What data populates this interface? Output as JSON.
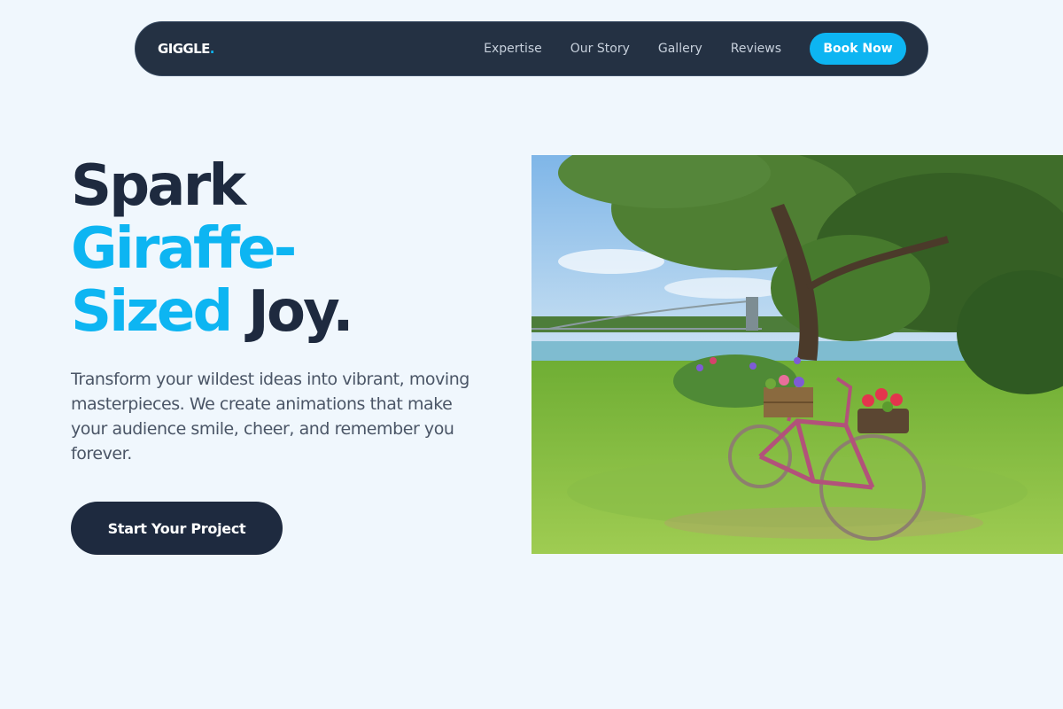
{
  "nav": {
    "logo": "GIGGLE",
    "logo_dot": ".",
    "links": [
      "Expertise",
      "Our Story",
      "Gallery",
      "Reviews"
    ],
    "cta": "Book Now"
  },
  "hero": {
    "title_line1": "Spark",
    "title_line2": "Giraffe-",
    "title_line3_accent": "Sized",
    "title_line3_rest": "Joy.",
    "description": "Transform your wildest ideas into vibrant, moving masterpieces. We create animations that make your audience smile, cheer, and remember you forever.",
    "cta": "Start Your Project"
  },
  "colors": {
    "background": "#f0f7fd",
    "nav_bg": "#243143",
    "accent": "#0db5f2",
    "dark": "#1e2a3f",
    "body_text": "#4a5566"
  }
}
